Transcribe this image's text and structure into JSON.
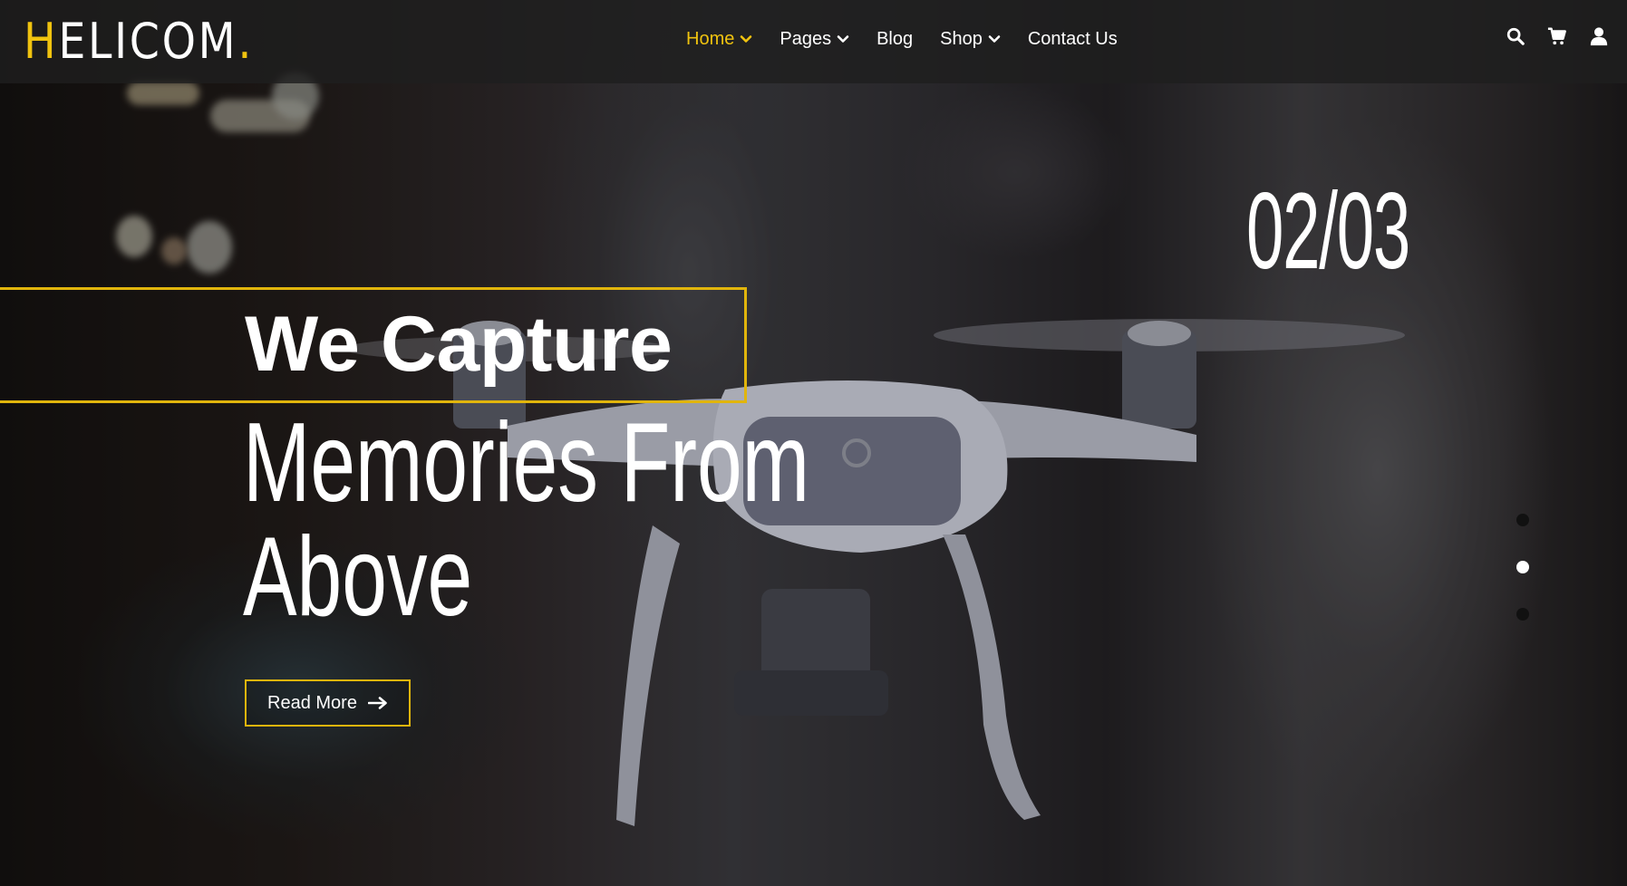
{
  "brand": {
    "first_letter": "H",
    "rest": "ELICOM",
    "dot": ".",
    "accent_color": "#f0c30f"
  },
  "nav": {
    "items": [
      {
        "label": "Home",
        "active": true,
        "has_dropdown": true
      },
      {
        "label": "Pages",
        "active": false,
        "has_dropdown": true
      },
      {
        "label": "Blog",
        "active": false,
        "has_dropdown": false
      },
      {
        "label": "Shop",
        "active": false,
        "has_dropdown": true
      },
      {
        "label": "Contact Us",
        "active": false,
        "has_dropdown": false
      }
    ]
  },
  "header_icons": [
    "search-icon",
    "cart-icon",
    "user-icon"
  ],
  "slider": {
    "counter": "02/03",
    "current": 2,
    "total": 3
  },
  "hero": {
    "title_bold": "We Capture",
    "title_line2": "Memories From",
    "title_line3": "Above",
    "cta_label": "Read More",
    "cta_icon": "arrow-right-icon"
  }
}
